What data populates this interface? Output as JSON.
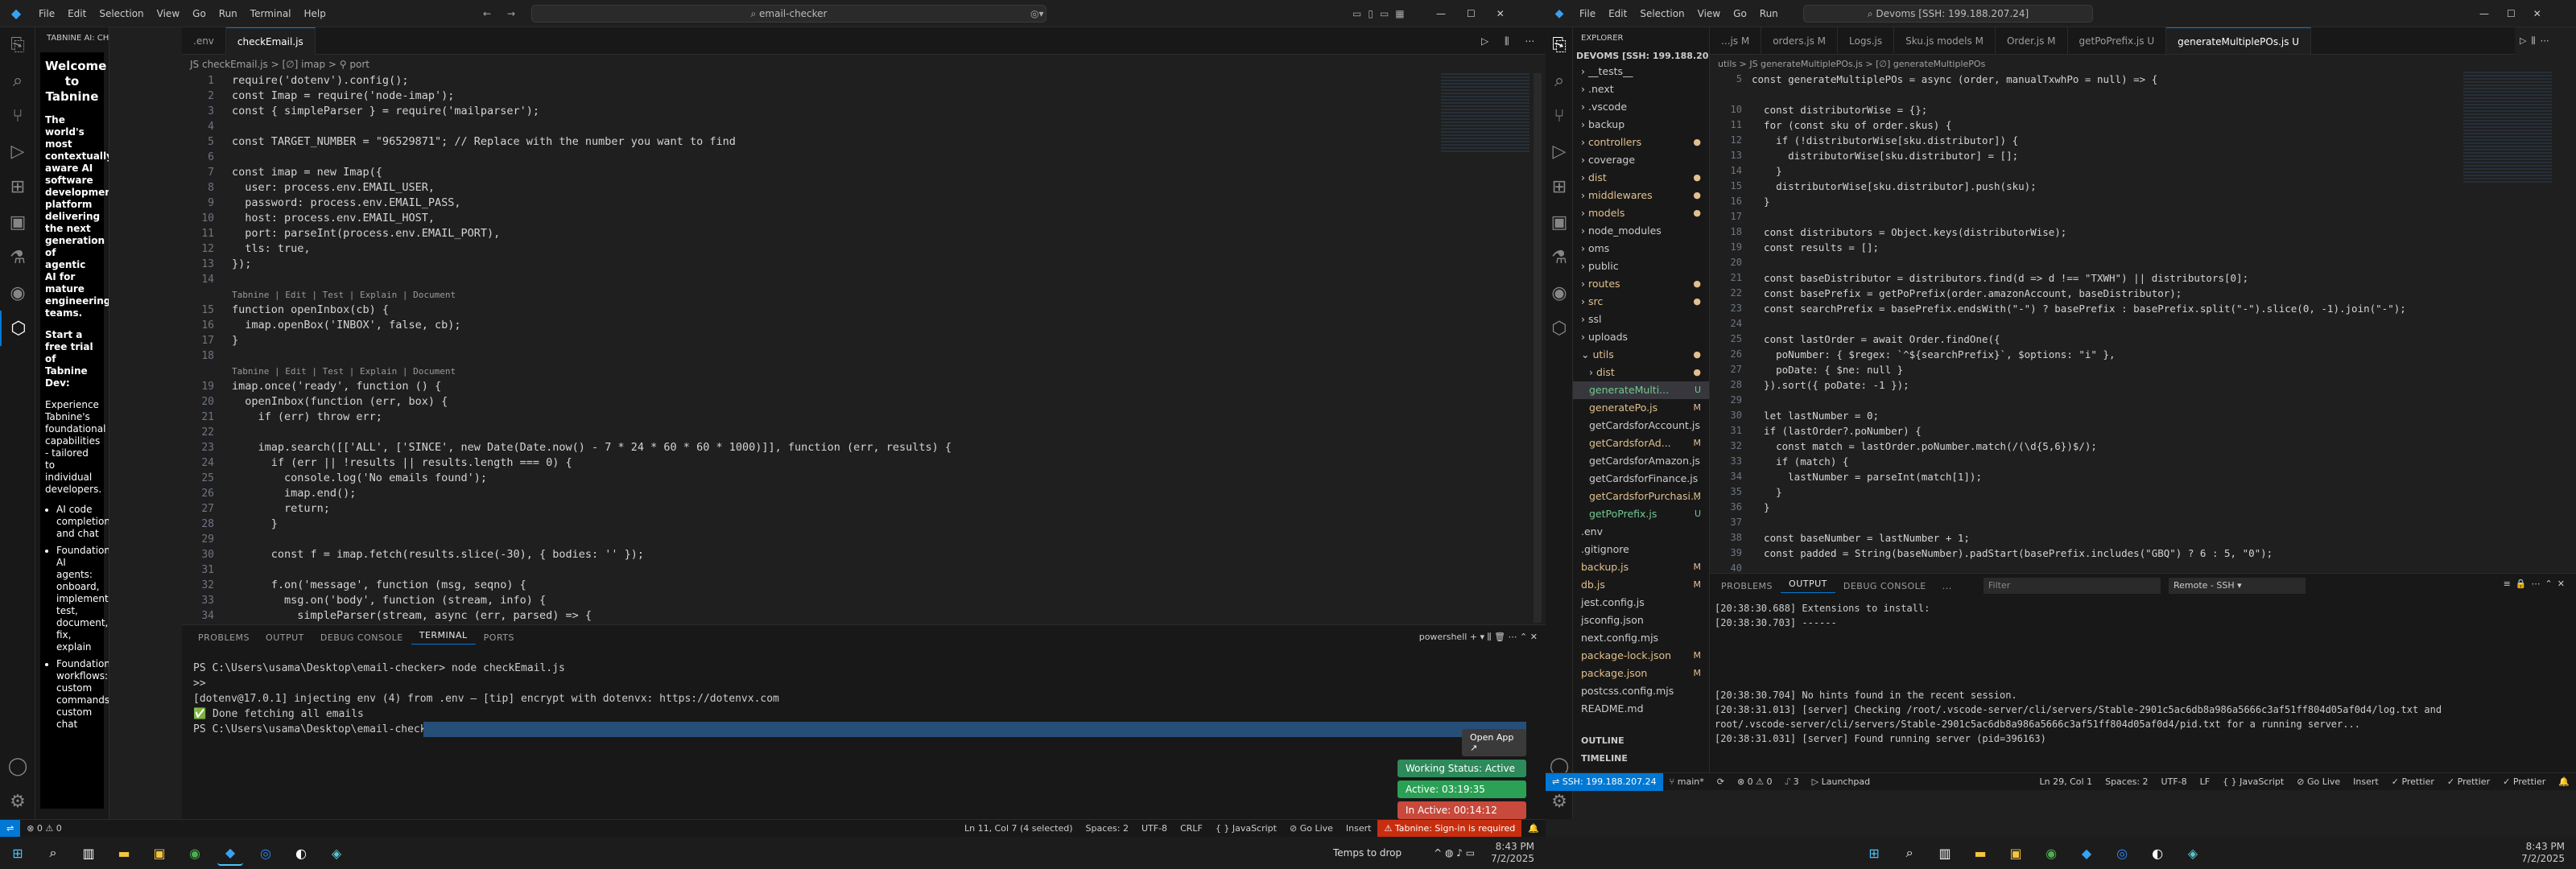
{
  "left": {
    "menu": [
      "File",
      "Edit",
      "Selection",
      "View",
      "Go",
      "Run",
      "Terminal",
      "Help"
    ],
    "command_center": "email-checker",
    "sidebar_title": "TABNINE AI: CHAT",
    "tabnine": {
      "heading": "Welcome to Tabnine",
      "intro": "The world's most contextually aware AI software development platform delivering the next generation of agentic AI for mature engineering teams.",
      "trial": "Start a free trial of Tabnine Dev:",
      "body": "Experience Tabnine's foundational capabilities - tailored to individual developers.",
      "bullets": [
        "AI code completions and chat",
        "Foundational AI agents: onboard, implement, test, document, fix, explain",
        "Foundational workflows: custom commands, custom chat"
      ]
    },
    "tabs": [
      {
        "label": ".env",
        "active": false
      },
      {
        "label": "checkEmail.js",
        "active": true
      }
    ],
    "breadcrumb": "JS checkEmail.js > [∅] imap > ⚲ port",
    "code_lines": [
      "require('dotenv').config();",
      "const Imap = require('node-imap');",
      "const { simpleParser } = require('mailparser');",
      "",
      "const TARGET_NUMBER = \"96529871\"; // Replace with the number you want to find",
      "",
      "const imap = new Imap({",
      "  user: process.env.EMAIL_USER,",
      "  password: process.env.EMAIL_PASS,",
      "  host: process.env.EMAIL_HOST,",
      "  port: parseInt(process.env.EMAIL_PORT),",
      "  tls: true,",
      "});",
      "",
      "Tabnine | Edit | Test | Explain | Document",
      "function openInbox(cb) {",
      "  imap.openBox('INBOX', false, cb);",
      "}",
      "",
      "Tabnine | Edit | Test | Explain | Document",
      "imap.once('ready', function () {",
      "  openInbox(function (err, box) {",
      "    if (err) throw err;",
      "",
      "    imap.search([['ALL', ['SINCE', new Date(Date.now() - 7 * 24 * 60 * 60 * 1000)]], function (err, results) {",
      "      if (err || !results || results.length === 0) {",
      "        console.log('No emails found');",
      "        imap.end();",
      "        return;",
      "      }",
      "",
      "      const f = imap.fetch(results.slice(-30), { bodies: '' });",
      "",
      "      f.on('message', function (msg, seqno) {",
      "        msg.on('body', function (stream, info) {",
      "          simpleParser(stream, async (err, parsed) => {"
    ],
    "line_numbers": [
      "1",
      "2",
      "3",
      "4",
      "5",
      "6",
      "7",
      "8",
      "9",
      "10",
      "11",
      "12",
      "13",
      "14",
      "",
      "15",
      "16",
      "17",
      "18",
      "",
      "19",
      "20",
      "21",
      "22",
      "23",
      "24",
      "25",
      "26",
      "27",
      "28",
      "29",
      "30",
      "31",
      "32",
      "33",
      "34"
    ],
    "panel_tabs": [
      "PROBLEMS",
      "OUTPUT",
      "DEBUG CONSOLE",
      "TERMINAL",
      "PORTS"
    ],
    "terminal_shell": "powershell",
    "terminal_lines": [
      "PS C:\\Users\\usama\\Desktop\\email-checker> node checkEmail.js",
      ">>",
      "[dotenv@17.0.1] injecting env (4) from .env – [tip] encrypt with dotenvx: https://dotenvx.com",
      "✅ Done fetching all emails",
      "PS C:\\Users\\usama\\Desktop\\email-checker> "
    ],
    "widgets": {
      "open_app": "Open App ↗",
      "working": "Working Status: Active",
      "active": "Active: 03:19:35",
      "inactive": "In Active: 00:14:12"
    },
    "status": {
      "errors": "⊗ 0 ⚠ 0",
      "position": "Ln 11, Col 7 (4 selected)",
      "spaces": "Spaces: 2",
      "encoding": "UTF-8",
      "eol": "CRLF",
      "lang": "{ } JavaScript",
      "golive": "⊘ Go Live",
      "insert": "Insert",
      "tabnine": "⚠ Tabnine: Sign-in is required"
    },
    "taskbar": {
      "temps": "Temps to drop",
      "time": "8:43 PM",
      "date": "7/2/2025"
    }
  },
  "right": {
    "menu": [
      "File",
      "Edit",
      "Selection",
      "View",
      "Go",
      "Run"
    ],
    "command_center": "Devoms [SSH: 199.188.207.24]",
    "explorer_title": "EXPLORER",
    "root": "DEVOMS [SSH: 199.188.20...",
    "tabs": [
      {
        "label": "...js M"
      },
      {
        "label": "orders.js M"
      },
      {
        "label": "Logs.js"
      },
      {
        "label": "Sku.js models M"
      },
      {
        "label": "Order.js M"
      },
      {
        "label": "getPoPrefix.js U"
      },
      {
        "label": "generateMultiplePOs.js U",
        "active": true
      }
    ],
    "breadcrumb": "utils > JS generateMultiplePOs.js > [∅] generateMultiplePOs",
    "tree": [
      {
        "n": "__tests__",
        "d": 1,
        "f": true
      },
      {
        "n": ".next",
        "d": 1,
        "f": true
      },
      {
        "n": ".vscode",
        "d": 1,
        "f": true
      },
      {
        "n": "backup",
        "d": 1,
        "f": true
      },
      {
        "n": "controllers",
        "d": 1,
        "f": true,
        "c": "#e2c08d",
        "s": "●"
      },
      {
        "n": "coverage",
        "d": 1,
        "f": true
      },
      {
        "n": "dist",
        "d": 1,
        "f": true,
        "c": "#e2c08d",
        "s": "●"
      },
      {
        "n": "middlewares",
        "d": 1,
        "f": true,
        "c": "#e2c08d",
        "s": "●"
      },
      {
        "n": "models",
        "d": 1,
        "f": true,
        "c": "#e2c08d",
        "s": "●"
      },
      {
        "n": "node_modules",
        "d": 1,
        "f": true
      },
      {
        "n": "oms",
        "d": 1,
        "f": true
      },
      {
        "n": "public",
        "d": 1,
        "f": true
      },
      {
        "n": "routes",
        "d": 1,
        "f": true,
        "c": "#e2c08d",
        "s": "●"
      },
      {
        "n": "src",
        "d": 1,
        "f": true,
        "c": "#e2c08d",
        "s": "●"
      },
      {
        "n": "ssl",
        "d": 1,
        "f": true
      },
      {
        "n": "uploads",
        "d": 1,
        "f": true
      },
      {
        "n": "utils",
        "d": 1,
        "f": true,
        "c": "#e2c08d",
        "s": "●",
        "open": true
      },
      {
        "n": "dist",
        "d": 2,
        "f": true,
        "c": "#e2c08d",
        "s": "●"
      },
      {
        "n": "generateMulti...",
        "d": 2,
        "c": "#73c991",
        "s": "U",
        "sel": true
      },
      {
        "n": "generatePo.js",
        "d": 2,
        "c": "#e2c08d",
        "s": "M"
      },
      {
        "n": "getCardsforAccount.js",
        "d": 2
      },
      {
        "n": "getCardsforAd...",
        "d": 2,
        "c": "#e2c08d",
        "s": "M"
      },
      {
        "n": "getCardsforAmazon.js",
        "d": 2
      },
      {
        "n": "getCardsforFinance.js",
        "d": 2
      },
      {
        "n": "getCardsforPurchasi...",
        "d": 2,
        "c": "#e2c08d",
        "s": "M"
      },
      {
        "n": "getPoPrefix.js",
        "d": 2,
        "c": "#73c991",
        "s": "U"
      },
      {
        "n": ".env",
        "d": 1
      },
      {
        "n": ".gitignore",
        "d": 1
      },
      {
        "n": "backup.js",
        "d": 1,
        "c": "#e2c08d",
        "s": "M"
      },
      {
        "n": "db.js",
        "d": 1,
        "c": "#e2c08d",
        "s": "M"
      },
      {
        "n": "jest.config.js",
        "d": 1
      },
      {
        "n": "jsconfig.json",
        "d": 1
      },
      {
        "n": "next.config.mjs",
        "d": 1
      },
      {
        "n": "package-lock.json",
        "d": 1,
        "c": "#e2c08d",
        "s": "M"
      },
      {
        "n": "package.json",
        "d": 1,
        "c": "#e2c08d",
        "s": "M"
      },
      {
        "n": "postcss.config.mjs",
        "d": 1
      },
      {
        "n": "README.md",
        "d": 1
      }
    ],
    "outline": "OUTLINE",
    "timeline": "TIMELINE",
    "line_numbers": [
      "5",
      "",
      "10",
      "11",
      "12",
      "13",
      "14",
      "15",
      "16",
      "17",
      "18",
      "19",
      "20",
      "21",
      "22",
      "23",
      "24",
      "25",
      "26",
      "27",
      "28",
      "29",
      "30",
      "31",
      "32",
      "33",
      "34",
      "35",
      "36",
      "37",
      "38",
      "39",
      "40"
    ],
    "code_lines": [
      "const generateMultiplePOs = async (order, manualTxwhPo = null) => {",
      "",
      "  const distributorWise = {};",
      "  for (const sku of order.skus) {",
      "    if (!distributorWise[sku.distributor]) {",
      "      distributorWise[sku.distributor] = [];",
      "    }",
      "    distributorWise[sku.distributor].push(sku);",
      "  }",
      "",
      "  const distributors = Object.keys(distributorWise);",
      "  const results = [];",
      "",
      "  const baseDistributor = distributors.find(d => d !== \"TXWH\") || distributors[0];",
      "  const basePrefix = getPoPrefix(order.amazonAccount, baseDistributor);",
      "  const searchPrefix = basePrefix.endsWith(\"-\") ? basePrefix : basePrefix.split(\"-\").slice(0, -1).join(\"-\");",
      "",
      "  const lastOrder = await Order.findOne({",
      "    poNumber: { $regex: `^${searchPrefix}`, $options: \"i\" },",
      "    poDate: { $ne: null }",
      "  }).sort({ poDate: -1 });",
      "",
      "  let lastNumber = 0;",
      "  if (lastOrder?.poNumber) {",
      "    const match = lastOrder.poNumber.match(/(\\d{5,6})$/);",
      "    if (match) {",
      "      lastNumber = parseInt(match[1]);",
      "    }",
      "  }",
      "",
      "  const baseNumber = lastNumber + 1;",
      "  const padded = String(baseNumber).padStart(basePrefix.includes(\"GBQ\") ? 6 : 5, \"0\");"
    ],
    "panel_tabs": [
      "PROBLEMS",
      "OUTPUT",
      "DEBUG CONSOLE",
      "..."
    ],
    "filter": "Filter",
    "output_select": "Remote - SSH",
    "output_lines": [
      "[20:38:30.688] Extensions to install:",
      "[20:38:30.703] ------",
      "",
      "",
      "",
      "",
      "[20:38:30.704] No hints found in the recent session.",
      "[20:38:31.013] [server] Checking /root/.vscode-server/cli/servers/Stable-2901c5ac6db8a986a5666c3af51ff804d05af0d4/log.txt and",
      "root/.vscode-server/cli/servers/Stable-2901c5ac6db8a986a5666c3af51ff804d05af0d4/pid.txt for a running server...",
      "[20:38:31.031] [server] Found running server (pid=396163)"
    ],
    "status": {
      "remote": "⇌ SSH: 199.188.207.24",
      "branch": "⑂ main*",
      "sync": "⟳",
      "errors": "⊗ 0 ⚠ 0",
      "ports": "⑀ 3",
      "launch": "▷ Launchpad",
      "position": "Ln 29, Col 1",
      "spaces": "Spaces: 2",
      "encoding": "UTF-8",
      "eol": "LF",
      "lang": "{ } JavaScript",
      "golive": "⊘ Go Live",
      "insert": "Insert",
      "prettier1": "✓ Prettier",
      "prettier2": "✓ Prettier",
      "prettier3": "✓ Prettier"
    },
    "taskbar": {
      "time": "8:43 PM",
      "date": "7/2/2025"
    }
  }
}
